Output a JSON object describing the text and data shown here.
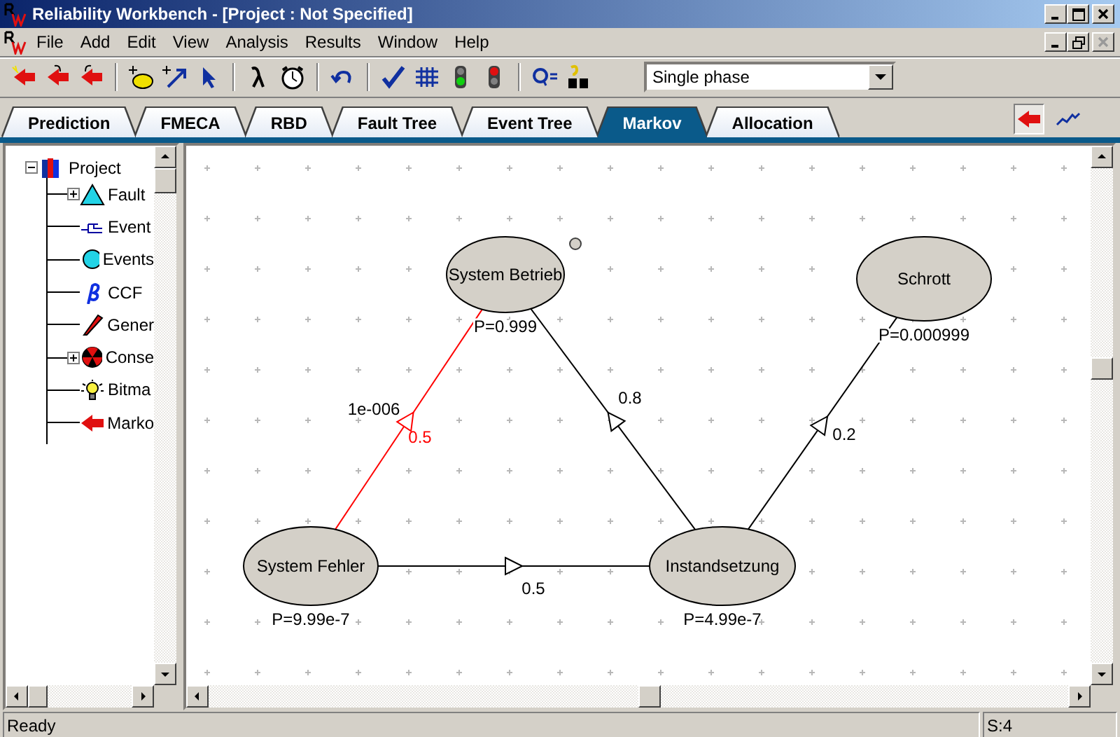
{
  "window": {
    "title": "Reliability Workbench - [Project : Not Specified]"
  },
  "menu": [
    "File",
    "Add",
    "Edit",
    "View",
    "Analysis",
    "Results",
    "Window",
    "Help"
  ],
  "toolbar": {
    "phase_select": {
      "value": "Single phase"
    }
  },
  "tabs": [
    {
      "label": "Prediction",
      "selected": false
    },
    {
      "label": "FMECA",
      "selected": false
    },
    {
      "label": "RBD",
      "selected": false
    },
    {
      "label": "Fault Tree",
      "selected": false
    },
    {
      "label": "Event Tree",
      "selected": false
    },
    {
      "label": "Markov",
      "selected": true
    },
    {
      "label": "Allocation",
      "selected": false
    }
  ],
  "view_buttons": [
    {
      "selected": true
    },
    {
      "selected": false
    }
  ],
  "tree": {
    "label": "Project",
    "expanded": true,
    "children": [
      {
        "label": "Fault",
        "expanded": false
      },
      {
        "label": "Event"
      },
      {
        "label": "Events"
      },
      {
        "label": "CCF"
      },
      {
        "label": "Gener"
      },
      {
        "label": "Conse",
        "expanded": false
      },
      {
        "label": "Bitma"
      },
      {
        "label": "Marko"
      }
    ]
  },
  "diagram": {
    "states": [
      {
        "name": "System Betrieb",
        "probability": "P=0.999"
      },
      {
        "name": "Schrott",
        "probability": "P=0.000999"
      },
      {
        "name": "System Fehler",
        "probability": "P=9.99e-7"
      },
      {
        "name": "Instandsetzung",
        "probability": "P=4.99e-7"
      }
    ],
    "transitions": [
      {
        "selected": true,
        "labels": [
          "1e-006",
          "0.5"
        ]
      },
      {
        "selected": false,
        "labels": [
          "0.8"
        ]
      },
      {
        "selected": false,
        "labels": [
          "0.2"
        ]
      },
      {
        "selected": false,
        "labels": [
          "0.5"
        ]
      }
    ]
  },
  "status_bar": {
    "message": "Ready",
    "position": "S:4"
  }
}
